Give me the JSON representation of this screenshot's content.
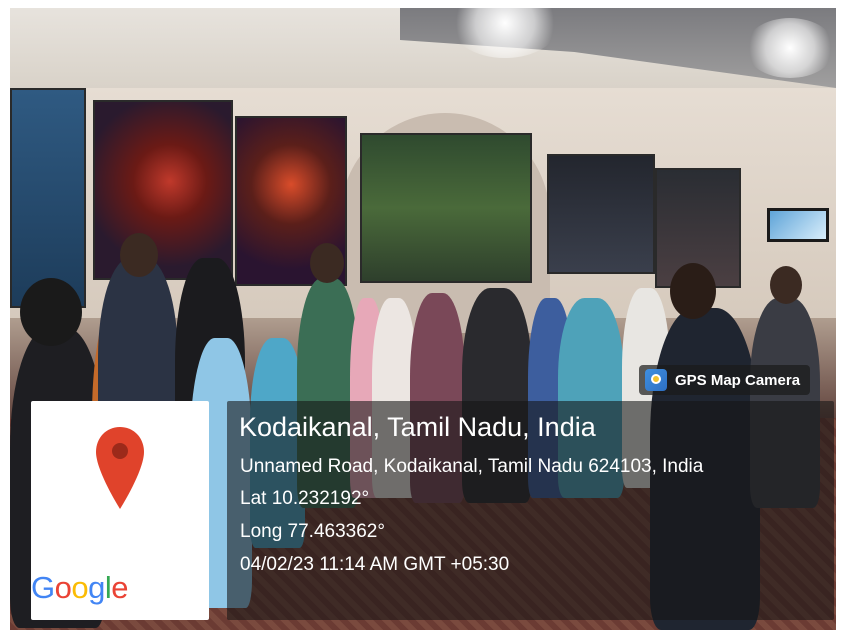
{
  "overlay": {
    "app_label": "GPS Map Camera",
    "app_icon": "gps-map-camera-icon",
    "map_icon": "map-pin-icon",
    "map_brand": [
      "G",
      "o",
      "o",
      "g",
      "l",
      "e"
    ],
    "map_brand_colors": [
      "#4285F4",
      "#EA4335",
      "#FBBC05",
      "#4285F4",
      "#34A853",
      "#EA4335"
    ],
    "location_title": "Kodaikanal, Tamil Nadu, India",
    "address": "Unnamed Road, Kodaikanal, Tamil Nadu 624103, India",
    "latitude": "Lat 10.232192°",
    "longitude": "Long 77.463362°",
    "timestamp": "04/02/23 11:14 AM GMT +05:30",
    "pin_color": "#E0432B"
  }
}
